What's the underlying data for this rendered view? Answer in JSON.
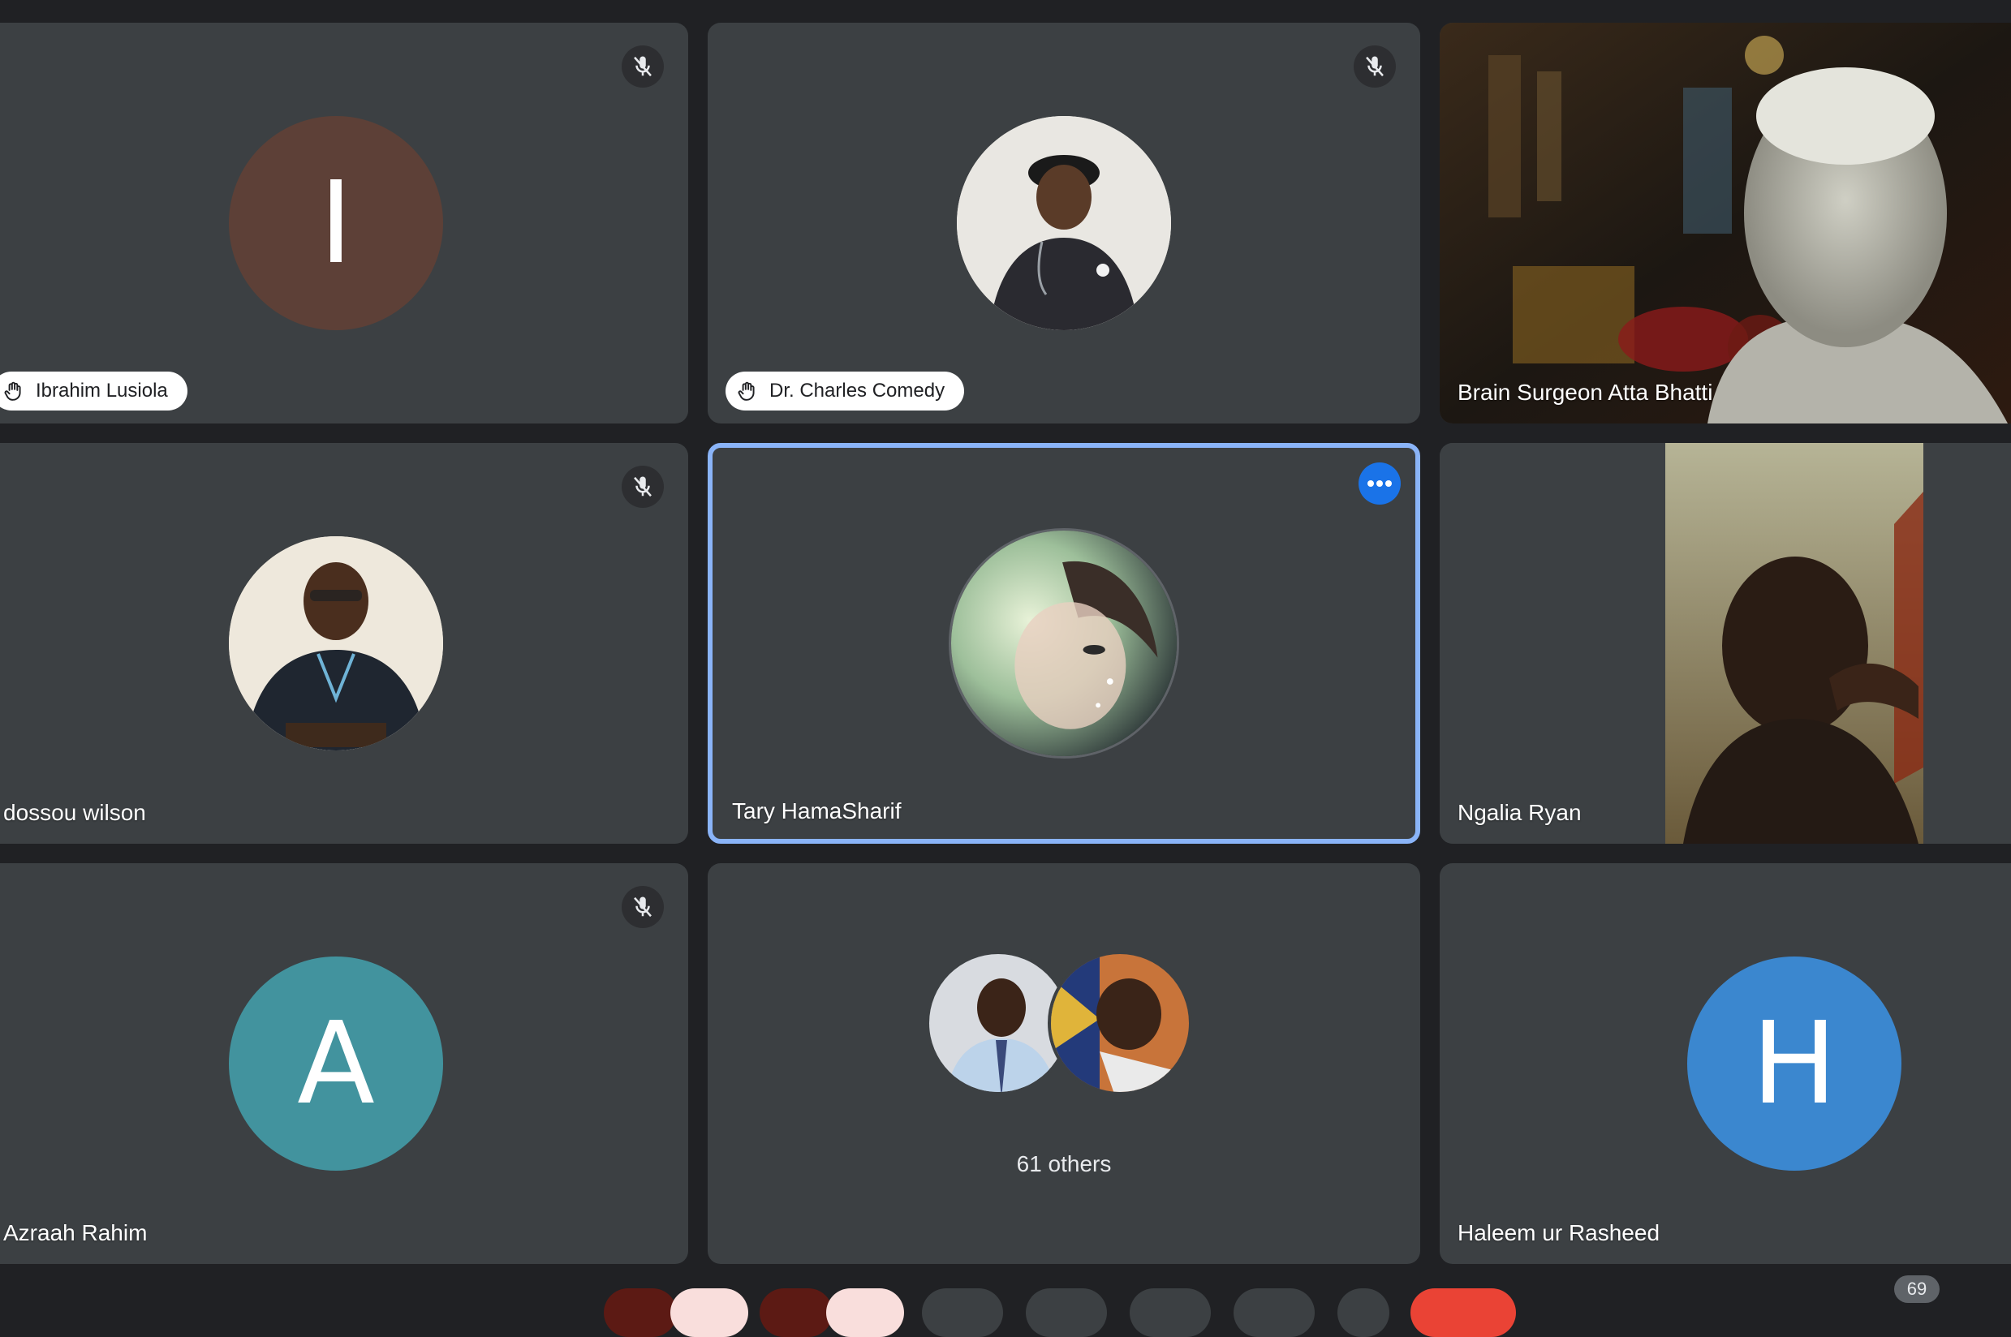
{
  "participants": [
    {
      "name": "Ibrahim Lusiola",
      "initial": "I",
      "avatar_color": "#5d4037",
      "muted": true,
      "hand_raised": true
    },
    {
      "name": "Dr. Charles Comedy",
      "muted": true,
      "hand_raised": true
    },
    {
      "name": "Brain Surgeon Atta Bhatti",
      "video_on": true
    },
    {
      "name": "dossou wilson",
      "muted": true
    },
    {
      "name": "Tary HamaSharif",
      "active_speaker": true
    },
    {
      "name": "Ngalia Ryan",
      "video_on": true
    },
    {
      "name": "Azraah Rahim",
      "initial": "A",
      "avatar_color": "#42939e",
      "muted": true
    },
    {
      "name": "Haleem ur Rasheed",
      "initial": "H",
      "avatar_color": "#3b87cf"
    }
  ],
  "others": {
    "label": "61 others"
  },
  "participant_count": "69",
  "colors": {
    "background": "#202124",
    "tile": "#3c4043",
    "active_border": "#8ab4f8",
    "accent": "#1a73e8",
    "end_call": "#ea4335"
  },
  "icons": {
    "mute": "mic-off-icon",
    "hand": "raised-hand-icon",
    "more": "more-options-icon"
  }
}
